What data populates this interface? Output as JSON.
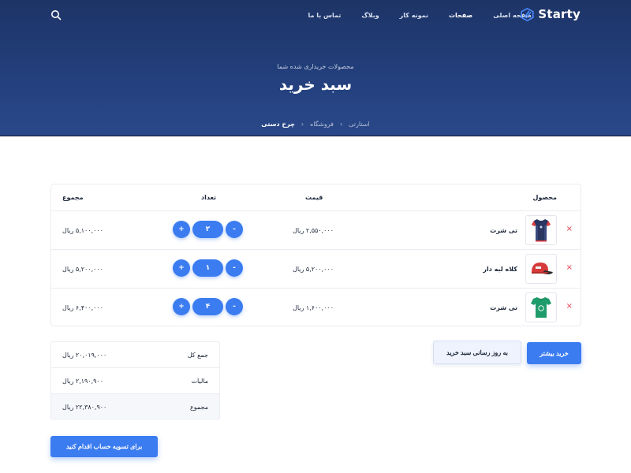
{
  "brand": {
    "name": "Starty"
  },
  "nav": {
    "items": [
      {
        "label": "صفحه اصلی"
      },
      {
        "label": "صفحات"
      },
      {
        "label": "نمونه کار"
      },
      {
        "label": "وبلاگ"
      },
      {
        "label": "تماس با ما"
      }
    ],
    "active_index": 1
  },
  "hero": {
    "subtitle": "محصولات خریداری شده شما",
    "title": "سبد خرید"
  },
  "breadcrumb": {
    "items": [
      "استارتی",
      "فروشگاه",
      "چرخ دستی"
    ],
    "separator": "‹"
  },
  "table": {
    "headers": {
      "product": "محصول",
      "price": "قیمت",
      "qty": "تعداد",
      "total": "مجموع"
    },
    "rows": [
      {
        "name": "تی شرت",
        "price": "۲,۵۵۰,۰۰۰ ریال",
        "qty": "۲",
        "total": "۵,۱۰۰,۰۰۰ ریال",
        "image": "tshirt-navy"
      },
      {
        "name": "کلاه لبه دار",
        "price": "۵,۲۰۰,۰۰۰ ریال",
        "qty": "۱",
        "total": "۵,۲۰۰,۰۰۰ ریال",
        "image": "cap-red"
      },
      {
        "name": "تی شرت",
        "price": "۱,۶۰۰,۰۰۰ ریال",
        "qty": "۴",
        "total": "۶,۴۰۰,۰۰۰ ریال",
        "image": "tshirt-green"
      }
    ],
    "remove_symbol": "×",
    "plus": "+",
    "minus": "-"
  },
  "actions": {
    "shop_more": "خرید بیشتر",
    "update_cart": "به روز رسانی سبد خرید",
    "checkout": "برای تسویه حساب اقدام کنید"
  },
  "summary": {
    "rows": [
      {
        "label": "جمع کل",
        "value": "۲۰,۰۱۹,۰۰۰ ریال"
      },
      {
        "label": "مالیات",
        "value": "۲,۱۹۰,۹۰۰ ریال"
      },
      {
        "label": "مجموع",
        "value": "۲۲,۳۸۰,۹۰۰ ریال"
      }
    ]
  },
  "colors": {
    "accent": "#3b7cf0",
    "hero_dark": "#1d3466",
    "remove": "#e63946"
  },
  "icons": {
    "search": "search-icon",
    "logo": "starty-logo-icon",
    "remove": "close-icon"
  }
}
